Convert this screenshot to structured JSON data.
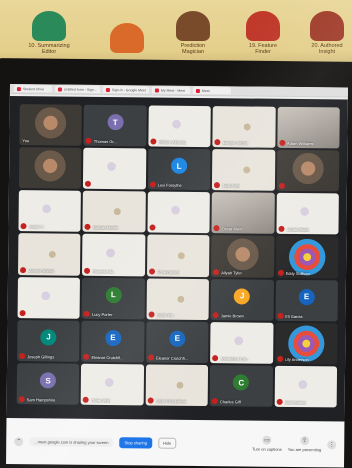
{
  "poster": {
    "cards": [
      {
        "label": "10. Summarizing\nEditor",
        "color": "#2b8a5a"
      },
      {
        "label": "",
        "color": "#d96a2a"
      },
      {
        "label": "Prediction\nMagician",
        "color": "#7a4b2a"
      },
      {
        "label": "19. Feature\nFinder",
        "color": "#c0392b"
      },
      {
        "label": "20. Authored\nInsight",
        "color": "#a03c2a"
      }
    ]
  },
  "browser": {
    "tabs": [
      {
        "label": "Student Drive"
      },
      {
        "label": "Untitled form - Sign..."
      },
      {
        "label": "Sign-in - Google Meet"
      },
      {
        "label": "My Meet - Meet"
      },
      {
        "label": "Meet"
      }
    ]
  },
  "meet": {
    "participants": [
      {
        "name": "You",
        "style": "face",
        "muted": false
      },
      {
        "name": "Thomas Gr...",
        "style": "avatar",
        "initial": "T",
        "avatar_color": "#7b6fb0",
        "muted": true
      },
      {
        "name": "William Albertso",
        "style": "paper",
        "muted": true
      },
      {
        "name": "Megan Jordan",
        "style": "paper2",
        "muted": true
      },
      {
        "name": "Adam Williams",
        "style": "room",
        "muted": true
      },
      {
        "name": "",
        "style": "face",
        "muted": false
      },
      {
        "name": "",
        "style": "paper",
        "muted": true
      },
      {
        "name": "Lexi Forsythe",
        "style": "avatar",
        "initial": "L",
        "avatar_color": "#1e88e5",
        "muted": true
      },
      {
        "name": "Jack Bally",
        "style": "paper2",
        "muted": true
      },
      {
        "name": "",
        "style": "face",
        "muted": true
      },
      {
        "name": "Jaden T...",
        "style": "paper",
        "muted": true
      },
      {
        "name": "Nathan Merritt",
        "style": "paper2",
        "muted": true
      },
      {
        "name": "",
        "style": "paper",
        "muted": true
      },
      {
        "name": "Oscar Klein",
        "style": "room",
        "muted": true
      },
      {
        "name": "Jordan Baker",
        "style": "paper",
        "muted": true
      },
      {
        "name": "Vanesa Walker",
        "style": "paper2",
        "muted": true
      },
      {
        "name": "Florence Al...",
        "style": "paper",
        "muted": true
      },
      {
        "name": "Ed Anderson",
        "style": "paper2",
        "muted": true
      },
      {
        "name": "Aliyah Tyler",
        "style": "face",
        "muted": true
      },
      {
        "name": "Eddy Sullivan",
        "style": "colorful",
        "muted": true
      },
      {
        "name": "",
        "style": "paper",
        "muted": true
      },
      {
        "name": "Lucy Porter",
        "style": "avatar",
        "initial": "L",
        "avatar_color": "#2e7d32",
        "muted": true
      },
      {
        "name": "Isaiah Pe...",
        "style": "paper2",
        "muted": true
      },
      {
        "name": "Jamie Brown",
        "style": "avatar",
        "initial": "J",
        "avatar_color": "#f9a825",
        "muted": true
      },
      {
        "name": "Eli Garcia",
        "style": "avatar",
        "initial": "E",
        "avatar_color": "#1565c0",
        "muted": true
      },
      {
        "name": "Joseph Gillings",
        "style": "avatar",
        "initial": "J",
        "avatar_color": "#00897b",
        "muted": true
      },
      {
        "name": "Eleanor Crutchfi...",
        "style": "avatar",
        "initial": "E",
        "avatar_color": "#1565c0",
        "muted": true
      },
      {
        "name": "Eleanor Crutchfi...",
        "style": "avatar",
        "initial": "E",
        "avatar_color": "#1565c0",
        "muted": true
      },
      {
        "name": "Johnathan Car...",
        "style": "paper",
        "muted": true
      },
      {
        "name": "Lily Anderson",
        "style": "colorful",
        "muted": true
      },
      {
        "name": "Sam Hampshire",
        "style": "avatar",
        "initial": "S",
        "avatar_color": "#7b6fb0",
        "muted": true
      },
      {
        "name": "Oliver Wyn",
        "style": "paper",
        "muted": true
      },
      {
        "name": "Carlo Flood-Henri",
        "style": "paper2",
        "muted": true
      },
      {
        "name": "Charles Giff",
        "style": "avatar",
        "initial": "C",
        "avatar_color": "#2e7d32",
        "muted": true
      },
      {
        "name": "Noel Gomez",
        "style": "paper",
        "muted": true
      }
    ],
    "toolbar": {
      "share_info": "...meet.google.com is sharing your screen",
      "stop_label": "Stop sharing",
      "hide_label": "Hide",
      "captions_label": "Turn on captions",
      "present_label": "You are presenting"
    }
  }
}
